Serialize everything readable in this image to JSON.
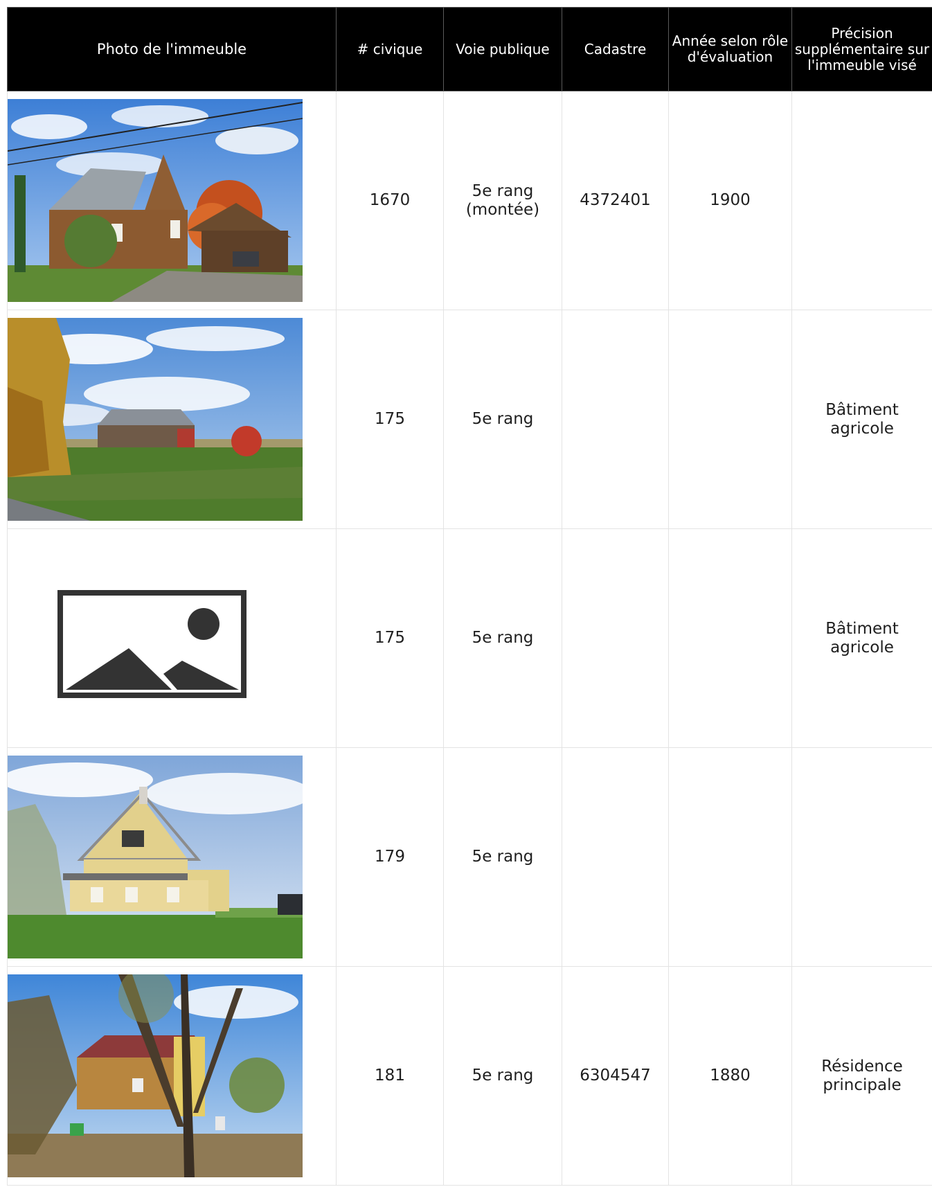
{
  "table": {
    "headers": {
      "photo": "Photo de l'immeuble",
      "civique": "# civique",
      "voie": "Voie publique",
      "cadastre": "Cadastre",
      "annee": "Année selon rôle d'évaluation",
      "precision": "Précision supplémentaire sur l'immeuble visé"
    },
    "rows": [
      {
        "photo_icon": "house-photo",
        "civique": "1670",
        "voie": "5e rang (montée)",
        "cadastre": "4372401",
        "annee": "1900",
        "precision": ""
      },
      {
        "photo_icon": "barn-photo",
        "civique": "175",
        "voie": "5e rang",
        "cadastre": "",
        "annee": "",
        "precision": "Bâtiment agricole"
      },
      {
        "photo_icon": "image-placeholder-icon",
        "civique": "175",
        "voie": "5e rang",
        "cadastre": "",
        "annee": "",
        "precision": "Bâtiment agricole"
      },
      {
        "photo_icon": "yellow-house-photo",
        "civique": "179",
        "voie": "5e rang",
        "cadastre": "",
        "annee": "",
        "precision": ""
      },
      {
        "photo_icon": "red-roof-house-photo",
        "civique": "181",
        "voie": "5e rang",
        "cadastre": "6304547",
        "annee": "1880",
        "precision": "Résidence principale"
      }
    ]
  }
}
